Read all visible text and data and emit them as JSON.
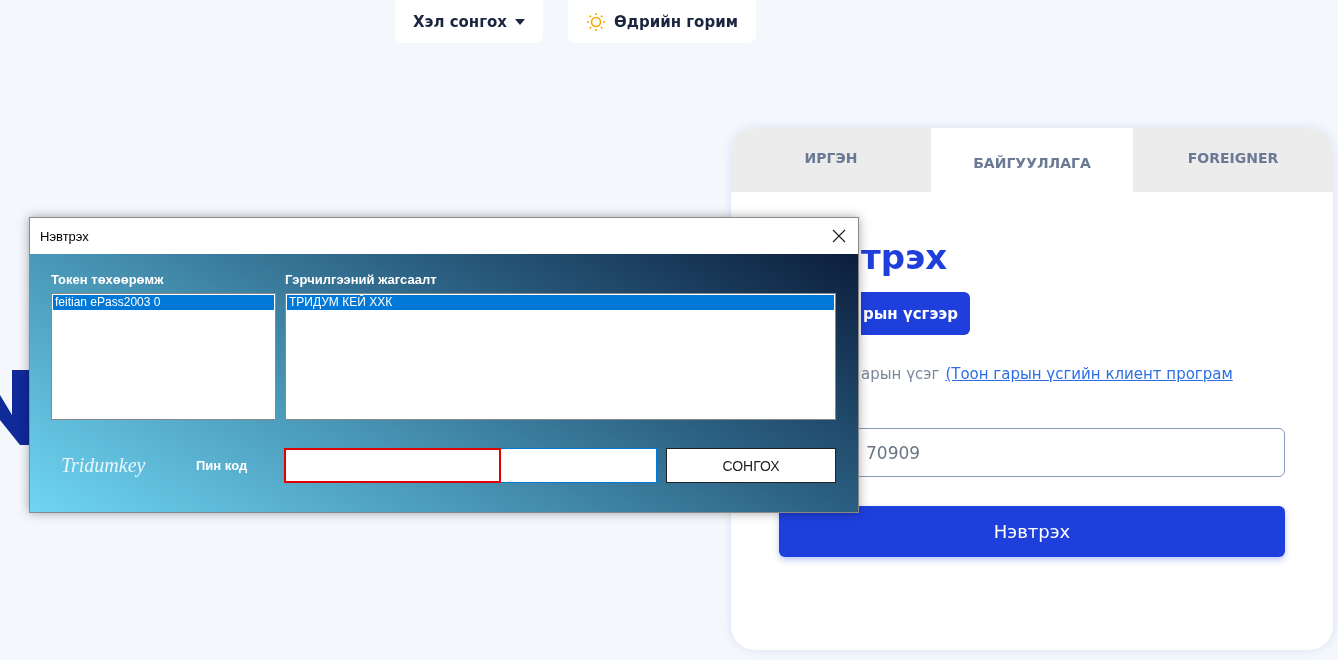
{
  "header": {
    "buttons": [
      {
        "kind": "dropdown",
        "label": "Хэл сонгох"
      },
      {
        "kind": "theme",
        "label": "Өдрийн горим"
      }
    ]
  },
  "login_card": {
    "tabs": [
      {
        "label": "ИРГЭН",
        "selected": false
      },
      {
        "label": "БАЙГУУЛЛАГА",
        "selected": true
      },
      {
        "label": "FOREIGNER",
        "selected": false
      }
    ],
    "title": "трэх",
    "method_button": "рын үсгээр",
    "hint": "арын үсэг",
    "hint_link": "(Тоон гарын үсгийн клиент програм",
    "field": {
      "value": "70909"
    },
    "submit": "Нэвтрэх"
  },
  "dialog": {
    "title": "Нэвтрэх",
    "token_label": "Токен төхөөрөмж",
    "tokens": [
      {
        "label": "feitian ePass2003 0",
        "selected": true
      }
    ],
    "cert_label": "Гэрчилгээний жагсаалт",
    "certificates": [
      {
        "label": "ТРИДУМ КЕЙ ХХК",
        "selected": true
      }
    ],
    "brand": "Tridumkey",
    "pin_label": "Пин код",
    "pin": {
      "highlighted": true
    },
    "select_button": "СОНГОХ"
  }
}
